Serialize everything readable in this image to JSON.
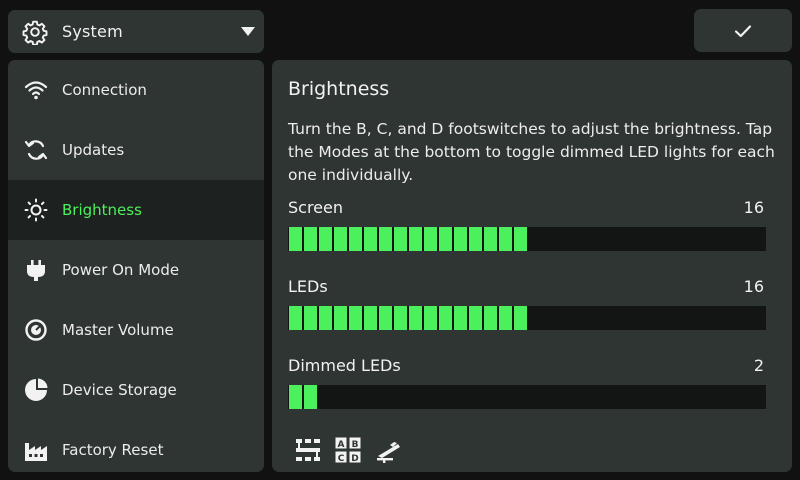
{
  "header": {
    "dropdown_label": "System",
    "dropdown_icon": "gear-icon",
    "confirm_icon": "checkmark-icon"
  },
  "sidebar": {
    "items": [
      {
        "label": "Connection",
        "icon": "wifi-icon",
        "active": false
      },
      {
        "label": "Updates",
        "icon": "refresh-icon",
        "active": false
      },
      {
        "label": "Brightness",
        "icon": "sun-icon",
        "active": true
      },
      {
        "label": "Power On Mode",
        "icon": "power-plug-icon",
        "active": false
      },
      {
        "label": "Master Volume",
        "icon": "volume-knob-icon",
        "active": false
      },
      {
        "label": "Device Storage",
        "icon": "pie-chart-icon",
        "active": false
      },
      {
        "label": "Factory Reset",
        "icon": "factory-icon",
        "active": false
      }
    ],
    "active_color": "#4cf05c"
  },
  "main": {
    "title": "Brightness",
    "description": "Turn the B, C, and D footswitches to adjust the brightness. Tap the Modes at the bottom to toggle dimmed LED lights for each one individually.",
    "sliders": [
      {
        "label": "Screen",
        "value": "16",
        "level": 16,
        "max": 32
      },
      {
        "label": "LEDs",
        "value": "16",
        "level": 16,
        "max": 32
      },
      {
        "label": "Dimmed LEDs",
        "value": "2",
        "level": 2,
        "max": 32
      }
    ],
    "mode_icons": [
      "stomp-grid-icon",
      "abcd-icon",
      "pedal-icon"
    ],
    "fill_color": "#4cf05c"
  }
}
